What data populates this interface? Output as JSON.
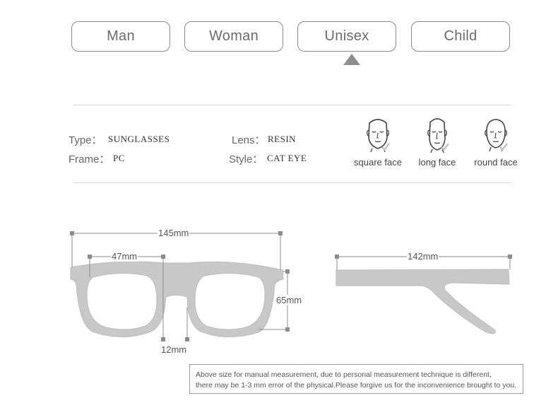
{
  "gender_tabs": [
    {
      "label": "Man",
      "selected": false
    },
    {
      "label": "Woman",
      "selected": false
    },
    {
      "label": "Unisex",
      "selected": true
    },
    {
      "label": "Child",
      "selected": false
    }
  ],
  "specs": {
    "type_label": "Type：",
    "type_value": "SUNGLASSES",
    "lens_label": "Lens：",
    "lens_value": "RESIN",
    "frame_label": "Frame：",
    "frame_value": "PC",
    "style_label": "Style：",
    "style_value": "CAT EYE"
  },
  "faces": [
    {
      "label": "square face",
      "icon": "square-face-icon"
    },
    {
      "label": "long face",
      "icon": "long-face-icon"
    },
    {
      "label": "round face",
      "icon": "round-face-icon"
    }
  ],
  "dimensions": {
    "total_width": "145mm",
    "lens_width": "47mm",
    "lens_height": "65mm",
    "bridge": "12mm",
    "temple_length": "142mm"
  },
  "note": {
    "line1": "Above size for manual measurement, due to personal measurement technique is different,",
    "line2": "there may be 1-3 mm error of the physical.Please forgive us for the inconvenience brought to you."
  },
  "colors": {
    "frame": "#c8c8c8",
    "dimension_line": "#8c8c8c",
    "selector_arrow": "#8e8e8e"
  }
}
